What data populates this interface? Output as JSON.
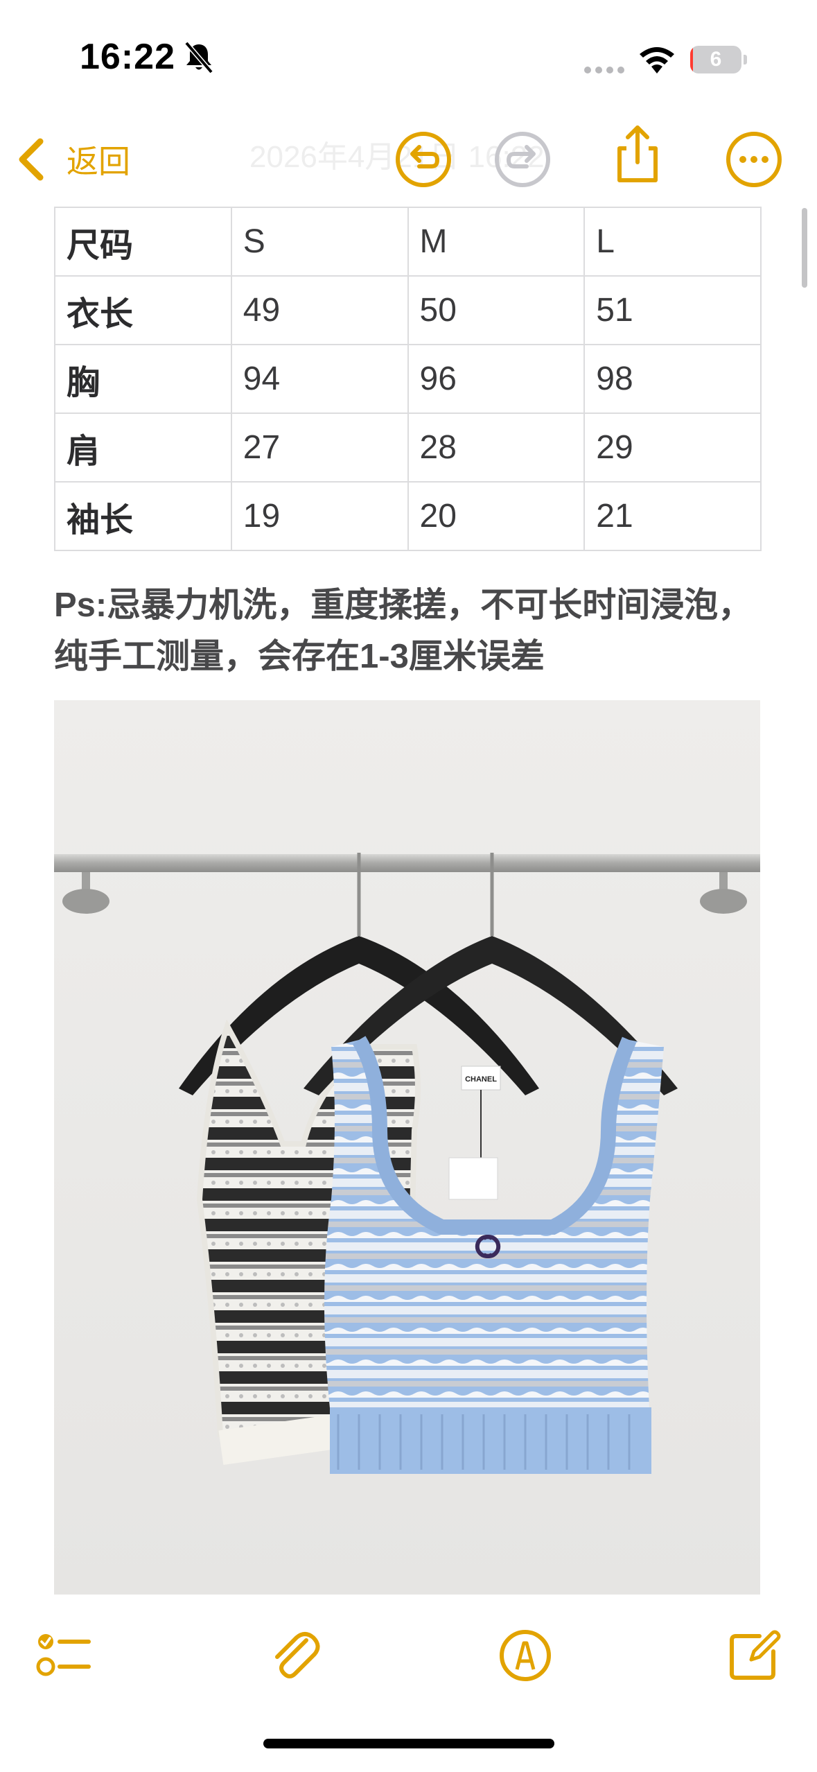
{
  "status_bar": {
    "time": "16:22",
    "battery_level": "6",
    "battery_fraction": 0.06,
    "icons": [
      "bell-slash-icon",
      "cellular-signal-icon",
      "wifi-icon",
      "battery-icon"
    ]
  },
  "nav": {
    "back_label": "返回",
    "faded_title": "2026年4月21日 16:22",
    "icons": [
      "chevron-left-icon",
      "undo-icon",
      "redo-icon",
      "share-icon",
      "more-icon"
    ],
    "accent_color": "#e2a300",
    "disabled_color": "#c7c7cc"
  },
  "size_table": {
    "header": [
      "尺码",
      "S",
      "M",
      "L"
    ],
    "rows": [
      [
        "衣长",
        "49",
        "50",
        "51"
      ],
      [
        "胸",
        "94",
        "96",
        "98"
      ],
      [
        "肩",
        "27",
        "28",
        "29"
      ],
      [
        "袖长",
        "19",
        "20",
        "21"
      ]
    ]
  },
  "note": {
    "line1": "Ps:忌暴力机洗，重度揉搓，不可长时间浸泡，",
    "line2": "纯手工测量，会存在1-3厘米误差"
  },
  "photo": {
    "tag_text": "CHANEL"
  },
  "toolbar": {
    "icons": [
      "checklist-icon",
      "paperclip-icon",
      "markup-pen-icon",
      "compose-icon"
    ]
  }
}
